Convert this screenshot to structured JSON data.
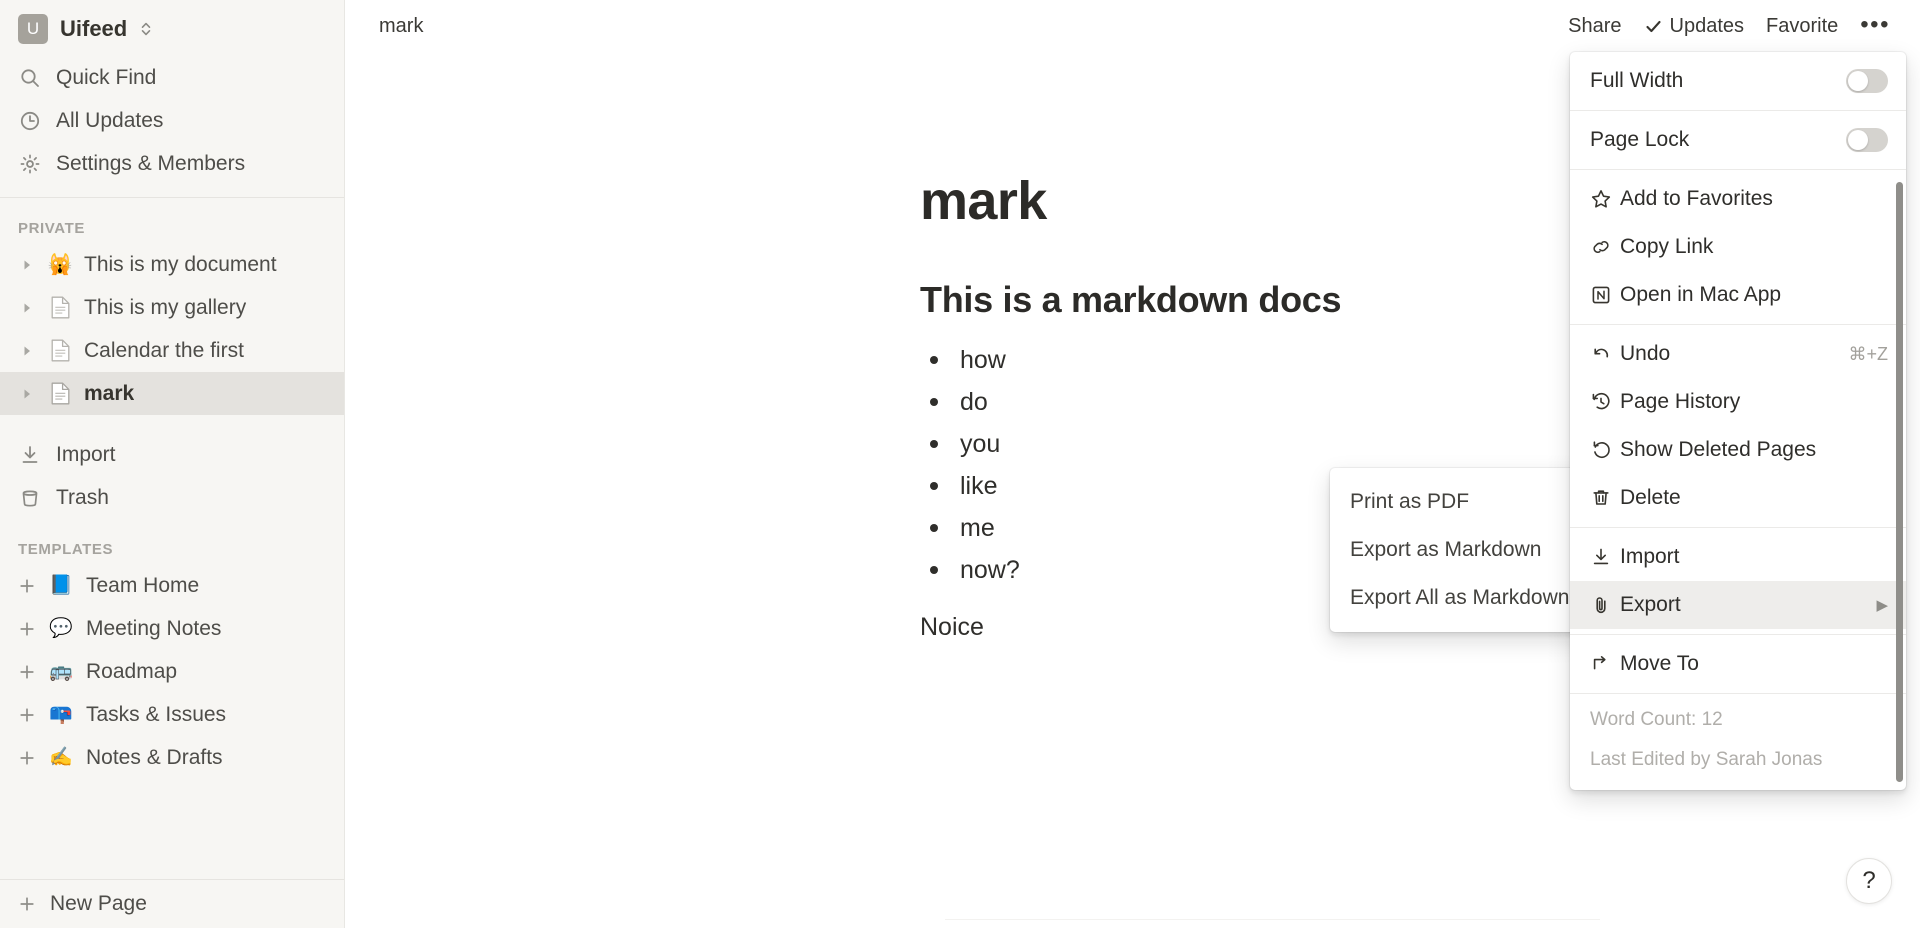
{
  "sidebar": {
    "workspace": {
      "initial": "U",
      "name": "Uifeed",
      "icon": "chevron-updown-icon"
    },
    "nav": [
      {
        "label": "Quick Find",
        "icon": "search-icon"
      },
      {
        "label": "All Updates",
        "icon": "clock-icon"
      },
      {
        "label": "Settings & Members",
        "icon": "gear-icon"
      }
    ],
    "private": {
      "title": "PRIVATE",
      "pages": [
        {
          "label": "This is my document",
          "emoji": "🙀",
          "icon": "page-emoji-cat",
          "selected": false
        },
        {
          "label": "This is my gallery",
          "emoji": "",
          "icon": "page-doc-icon",
          "selected": false
        },
        {
          "label": "Calendar the first",
          "emoji": "",
          "icon": "page-doc-icon",
          "selected": false
        },
        {
          "label": "mark",
          "emoji": "",
          "icon": "page-doc-icon",
          "selected": true
        }
      ]
    },
    "tools": [
      {
        "label": "Import",
        "icon": "import-icon"
      },
      {
        "label": "Trash",
        "icon": "trash-icon"
      }
    ],
    "templates": {
      "title": "TEMPLATES",
      "items": [
        {
          "label": "Team Home",
          "emoji": "📘",
          "icon": "template-team-home-icon"
        },
        {
          "label": "Meeting Notes",
          "emoji": "💬",
          "icon": "template-meeting-notes-icon"
        },
        {
          "label": "Roadmap",
          "emoji": "🚌",
          "icon": "template-roadmap-icon"
        },
        {
          "label": "Tasks & Issues",
          "emoji": "📪",
          "icon": "template-tasks-issues-icon"
        },
        {
          "label": "Notes & Drafts",
          "emoji": "✍️",
          "icon": "template-notes-drafts-icon"
        }
      ]
    },
    "new_page": {
      "label": "New Page",
      "icon": "plus-icon"
    }
  },
  "topbar": {
    "breadcrumb": "mark",
    "share": "Share",
    "updates": "Updates",
    "updates_icon": "check-icon",
    "favorite": "Favorite",
    "more": "•••",
    "more_icon": "ellipsis-icon"
  },
  "document": {
    "title": "mark",
    "heading": "This is a markdown docs",
    "bullets": [
      "how",
      "do",
      "you",
      "like",
      "me",
      "now?"
    ],
    "paragraph": "Noice"
  },
  "menu": {
    "full_width": {
      "label": "Full Width",
      "state": "off"
    },
    "page_lock": {
      "label": "Page Lock",
      "state": "off"
    },
    "group_links": [
      {
        "label": "Add to Favorites",
        "icon": "star-icon"
      },
      {
        "label": "Copy Link",
        "icon": "link-icon"
      },
      {
        "label": "Open in Mac App",
        "icon": "notion-app-icon"
      }
    ],
    "group_history": [
      {
        "label": "Undo",
        "icon": "undo-icon",
        "accel": "⌘+Z"
      },
      {
        "label": "Page History",
        "icon": "page-history-icon",
        "accel": ""
      },
      {
        "label": "Show Deleted Pages",
        "icon": "restore-icon",
        "accel": ""
      },
      {
        "label": "Delete",
        "icon": "trash-icon",
        "accel": ""
      }
    ],
    "group_transfer": [
      {
        "label": "Import",
        "icon": "import-icon",
        "arrow": "",
        "active": false
      },
      {
        "label": "Export",
        "icon": "paperclip-icon",
        "arrow": "▶",
        "active": true
      }
    ],
    "group_move": [
      {
        "label": "Move To",
        "icon": "move-to-icon",
        "arrow": "",
        "active": false
      }
    ],
    "word_count": "Word Count: 12",
    "last_edited": "Last Edited by Sarah Jonas"
  },
  "submenu": {
    "items": [
      "Print as PDF",
      "Export as Markdown",
      "Export All as Markdown"
    ]
  },
  "help": {
    "label": "?"
  },
  "colors": {
    "sidebar_bg": "#f7f6f3",
    "selected_row": "#e4e2de",
    "text": "#37352f",
    "muted": "#a5a39e",
    "accent": "#2eaadc"
  }
}
